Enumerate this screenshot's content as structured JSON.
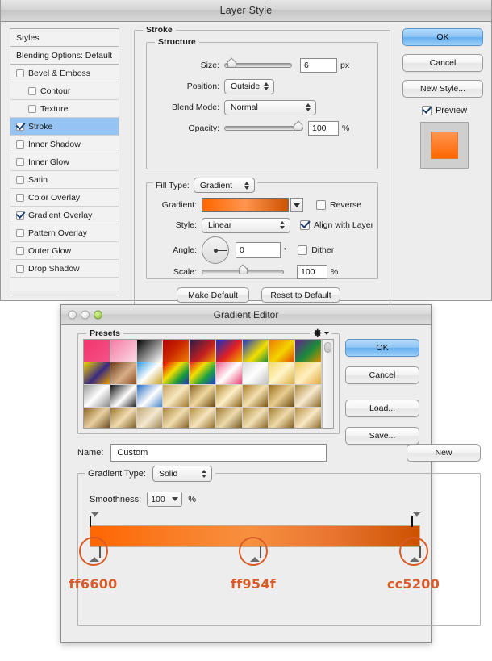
{
  "layer_style": {
    "title": "Layer Style",
    "styles_pane": {
      "header_label": "Styles",
      "blending_label": "Blending Options: Default",
      "items": [
        {
          "label": "Bevel & Emboss",
          "checked": false,
          "indent": false,
          "selected": false
        },
        {
          "label": "Contour",
          "checked": false,
          "indent": true,
          "selected": false
        },
        {
          "label": "Texture",
          "checked": false,
          "indent": true,
          "selected": false
        },
        {
          "label": "Stroke",
          "checked": true,
          "indent": false,
          "selected": true
        },
        {
          "label": "Inner Shadow",
          "checked": false,
          "indent": false,
          "selected": false
        },
        {
          "label": "Inner Glow",
          "checked": false,
          "indent": false,
          "selected": false
        },
        {
          "label": "Satin",
          "checked": false,
          "indent": false,
          "selected": false
        },
        {
          "label": "Color Overlay",
          "checked": false,
          "indent": false,
          "selected": false
        },
        {
          "label": "Gradient Overlay",
          "checked": true,
          "indent": false,
          "selected": false
        },
        {
          "label": "Pattern Overlay",
          "checked": false,
          "indent": false,
          "selected": false
        },
        {
          "label": "Outer Glow",
          "checked": false,
          "indent": false,
          "selected": false
        },
        {
          "label": "Drop Shadow",
          "checked": false,
          "indent": false,
          "selected": false
        }
      ]
    },
    "stroke_group_label": "Stroke",
    "structure": {
      "group_label": "Structure",
      "size_label": "Size:",
      "size_value": "6",
      "size_unit": "px",
      "size_slider_percent": 4,
      "position_label": "Position:",
      "position_value": "Outside",
      "blend_mode_label": "Blend Mode:",
      "blend_mode_value": "Normal",
      "opacity_label": "Opacity:",
      "opacity_value": "100",
      "opacity_unit": "%",
      "opacity_slider_percent": 100
    },
    "fill_type": {
      "label": "Fill Type:",
      "value": "Gradient",
      "gradient_label": "Gradient:",
      "gradient_preview_colors": [
        "#ff6600",
        "#ff954f",
        "#cc5200"
      ],
      "reverse_label": "Reverse",
      "reverse_checked": false,
      "style_label": "Style:",
      "style_value": "Linear",
      "align_label": "Align with Layer",
      "align_checked": true,
      "angle_label": "Angle:",
      "angle_value": "0",
      "angle_unit": "°",
      "dither_label": "Dither",
      "dither_checked": false,
      "scale_label": "Scale:",
      "scale_value": "100",
      "scale_unit": "%",
      "scale_slider_percent": 50
    },
    "footer_buttons": [
      {
        "label": "Make Default"
      },
      {
        "label": "Reset to Default"
      }
    ],
    "right_buttons": [
      {
        "label": "OK",
        "primary": true
      },
      {
        "label": "Cancel",
        "primary": false
      },
      {
        "label": "New Style...",
        "primary": false
      }
    ],
    "preview_label": "Preview",
    "preview_checked": true
  },
  "gradient_editor": {
    "title": "Gradient Editor",
    "presets_label": "Presets",
    "gear_icon": "gear-icon",
    "presets_swatches": [
      "linear-gradient(135deg,#f2356b,#f4528a)",
      "linear-gradient(135deg,#f47ca6,#fbd9e4)",
      "linear-gradient(135deg,#000,#fff)",
      "linear-gradient(135deg,#b00000,#cc2b00 50%,#f08000)",
      "linear-gradient(135deg,#2b1a4a,#c42020 60%,#f0a000)",
      "linear-gradient(135deg,#1530c0,#e02020 55%,#f2b000)",
      "linear-gradient(135deg,#1a33c8,#f2e000 60%,#2a8f3a)",
      "linear-gradient(135deg,#e87a00,#f5d400 55%,#e04a00)",
      "linear-gradient(135deg,#6a2090,#1a8a3a 55%,#e09000)",
      "linear-gradient(135deg,#f2d000,#3a2a80 55%,#e8a000)",
      "linear-gradient(135deg,#6a3a18,#d8b088 55%,#8a4a20)",
      "linear-gradient(135deg,#2f9ae0,#ffffff 50%,#c8a020)",
      "linear-gradient(135deg,#e00000,#f2e000 40%,#1a9a3a 70%,#2030c0)",
      "linear-gradient(135deg,#e02020,#f2e000 35%,#20a040 65%,#2040d0)",
      "linear-gradient(135deg,#f06090,#ffffff 50%,#e84070)",
      "linear-gradient(135deg,#d8d8d8,#ffffff 50%,#c0c0c0)",
      "linear-gradient(135deg,#f2d86a,#fff4c8 50%,#d8b040)",
      "linear-gradient(135deg,#f0c860,#fff0c0 50%,#e0a840)",
      "linear-gradient(135deg,#9a9a9a,#ffffff 50%,#8a8a8a)",
      "linear-gradient(135deg,#101010,#ffffff 55%,#202020)",
      "linear-gradient(135deg,#2b6fc0,#ffffff 55%,#4a86c8)",
      "linear-gradient(135deg,#c8a060,#f8e8c0 50%,#a07830)",
      "linear-gradient(135deg,#8a6020,#f0d8a0 50%,#6a4810)",
      "linear-gradient(135deg,#b08830,#fff0c8 50%,#8a6418)",
      "linear-gradient(135deg,#a87c28,#f4e0b0 50%,#7c5614)",
      "linear-gradient(135deg,#9a7020,#e8cc90 50%,#6e4c10)",
      "linear-gradient(135deg,#b08a40,#f8ead0 50%,#8a6a28)",
      "linear-gradient(135deg,#8a6428,#e8d0a0 50%,#6a4818)",
      "linear-gradient(135deg,#9a7430,#f0dcb0 50%,#74541c)",
      "linear-gradient(135deg,#c0a878,#f4e8d0 50%,#9a8050)",
      "linear-gradient(135deg,#a8843c,#f0dcae 50%,#7e5c1e)",
      "linear-gradient(135deg,#b28c40,#f6e4bc 50%,#86641f)",
      "linear-gradient(135deg,#9c7630,#eedcae 50%,#6e5018)",
      "linear-gradient(135deg,#ae8a3c,#f2e0b6 50%,#825e1c)",
      "linear-gradient(135deg,#a07a34,#eedaa8 50%,#785416)",
      "linear-gradient(135deg,#b89046,#f8e8c4 50%,#8a6624)"
    ],
    "name_label": "Name:",
    "name_value": "Custom",
    "new_button_label": "New",
    "gradient_type_label": "Gradient Type:",
    "gradient_type_value": "Solid",
    "smoothness_label": "Smoothness:",
    "smoothness_value": "100",
    "smoothness_unit": "%",
    "right_buttons": [
      {
        "label": "OK",
        "primary": true
      },
      {
        "label": "Cancel",
        "primary": false
      },
      {
        "label": "Load...",
        "primary": false
      },
      {
        "label": "Save...",
        "primary": false
      }
    ],
    "gradient_bar": {
      "css": "linear-gradient(to right,#ff6600 0%,#fa7a22 22%,#f7903f 48%,#e87430 74%,#cc5200 100%)",
      "opacity_stops": [
        {
          "position": 0
        },
        {
          "position": 100
        }
      ],
      "color_stops": [
        {
          "position": 0,
          "hex": "ff6600",
          "color": "#ff6600"
        },
        {
          "position": 50,
          "hex": "ff954f",
          "color": "#ff954f"
        },
        {
          "position": 100,
          "hex": "cc5200",
          "color": "#cc5200"
        }
      ]
    },
    "annotation_color": "#d95b28"
  }
}
